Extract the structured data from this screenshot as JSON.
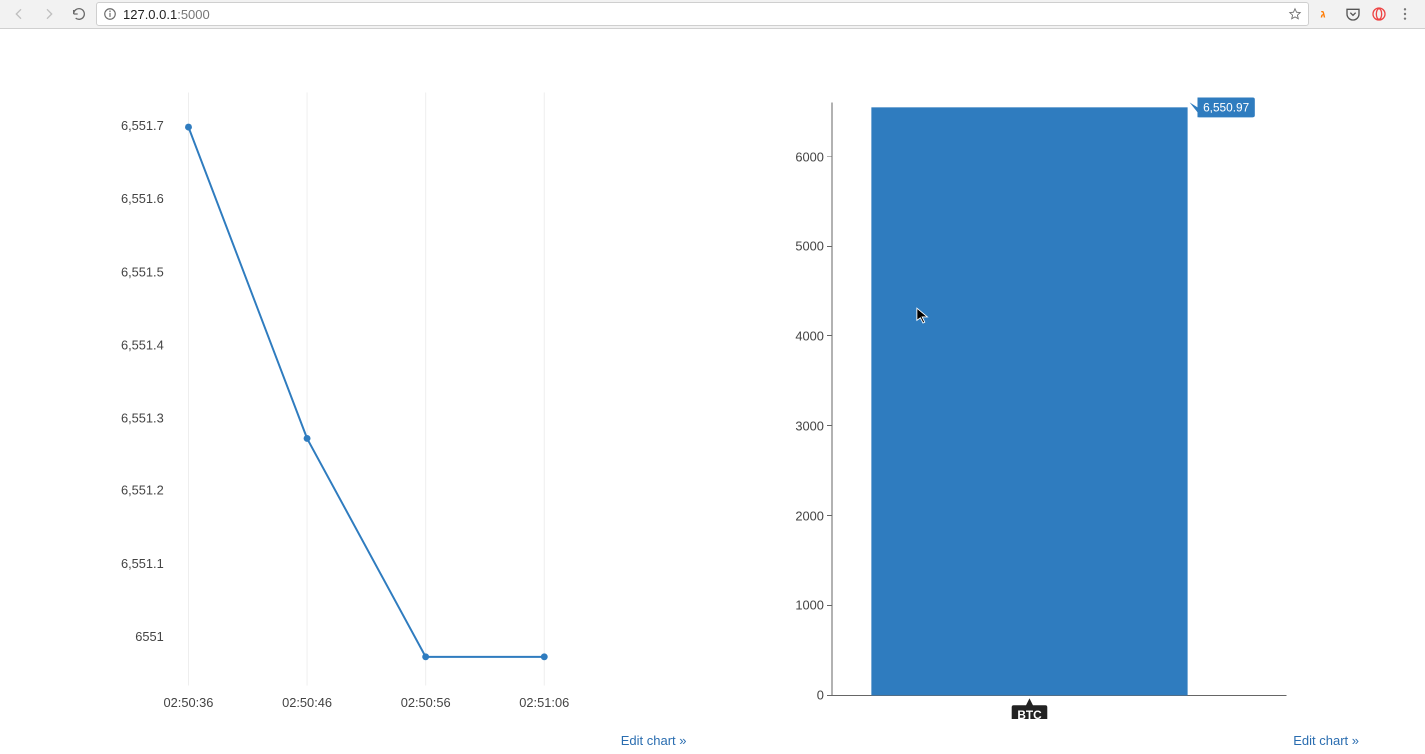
{
  "toolbar": {
    "url_host": "127.0.0.1",
    "url_port": ":5000"
  },
  "link": {
    "edit_chart": "Edit chart »"
  },
  "chart_data": [
    {
      "type": "line",
      "x": [
        "02:50:36",
        "02:50:46",
        "02:50:56",
        "02:51:06"
      ],
      "values": [
        6551.72,
        6551.28,
        6550.97,
        6550.97
      ],
      "y_ticks": [
        6551,
        6551.1,
        6551.2,
        6551.3,
        6551.4,
        6551.5,
        6551.6,
        6551.7
      ],
      "y_tick_labels": [
        "6551",
        "6,551.1",
        "6,551.2",
        "6,551.3",
        "6,551.4",
        "6,551.5",
        "6,551.6",
        "6,551.7"
      ],
      "ylim": [
        6550.93,
        6551.77
      ],
      "xlabel": "",
      "ylabel": "",
      "title": ""
    },
    {
      "type": "bar",
      "categories": [
        "BTC"
      ],
      "values": [
        6550.97
      ],
      "value_label": "6,550.97",
      "y_ticks": [
        0,
        1000,
        2000,
        3000,
        4000,
        5000,
        6000
      ],
      "ylim": [
        0,
        6600
      ],
      "xlabel": "",
      "ylabel": "",
      "title": ""
    }
  ]
}
